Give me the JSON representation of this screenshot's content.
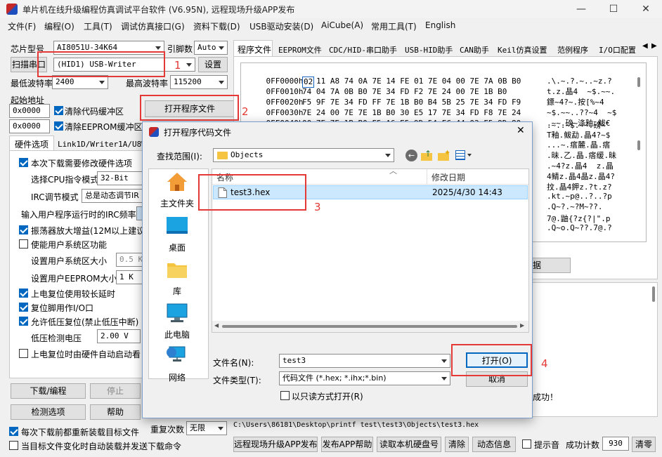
{
  "window": {
    "title": "单片机在线升级编程仿真调试平台软件 (V6.95N), 远程现场升级APP发布",
    "minimize": "—",
    "maximize": "☐",
    "close": "✕"
  },
  "menu": [
    "文件(F)",
    "编程(O)",
    "工具(T)",
    "调试仿真接口(G)",
    "资料下载(D)",
    "USB驱动安装(D)",
    "AiCube(A)",
    "常用工具(T)",
    "English"
  ],
  "left": {
    "chip_label": "芯片型号",
    "chip_value": "AI8051U-34K64",
    "pin_label": "引脚数",
    "pin_value": "Auto",
    "scan_label": "扫描串口",
    "port_value": "(HID1) USB-Writer",
    "settings_btn": "设置",
    "min_baud_label": "最低波特率",
    "min_baud": "2400",
    "max_baud_label": "最高波特率",
    "max_baud": "115200",
    "start_addr_label": "起始地址",
    "addr1": "0x0000",
    "clear_code": "清除代码缓冲区",
    "addr2": "0x0000",
    "clear_eeprom": "清除EEPROM缓冲区",
    "open_prog_btn": "打开程序文件",
    "tab1": "硬件选项",
    "tab2": "Link1D/Writer1A/U8W脱",
    "opt_changehw": "本次下载需要修改硬件选项",
    "cpu_label": "选择CPU指令模式",
    "cpu_value": "32-Bit",
    "irc_label": "IRC调节模式",
    "irc_value": "总是动态调节IR",
    "irc_freq_label": "输入用户程序运行时的IRC频率",
    "osc_gain": "振荡器放大增益(12M以上建议",
    "user_sys": "使能用户系统区功能",
    "user_sys_size_label": "设置用户系统区大小",
    "user_sys_size": "0.5 K",
    "user_eeprom_label": "设置用户EEPROM大小",
    "user_eeprom": "1  K",
    "long_delay": "上电复位使用较长延时",
    "reset_io": "复位脚用作I/O口",
    "lvr": "允许低压复位(禁止低压中断)",
    "lvd_label": "低压检测电压",
    "lvd_value": "2.00 V",
    "auto_start": "上电复位时由硬件自动启动看",
    "download_btn": "下载/编程",
    "stop_btn": "停止",
    "check_btn": "检测选项",
    "help_btn": "帮助",
    "reload_each": "每次下载前都重新装载目标文件",
    "repeat_label": "重复次数",
    "repeat_value": "无限",
    "auto_send": "当目标文件变化时自动装载并发送下载命令"
  },
  "right": {
    "tabs": [
      "程序文件",
      "EEPROM文件",
      "CDC/HID-串口助手",
      "USB-HID助手",
      "CAN助手",
      "Keil仿真设置",
      "范例程序",
      "I/O口配置"
    ],
    "hex_rows": [
      {
        "addr": "0FF0000h",
        "first": "02",
        "bytes": "11 A8 74 0A 7E 14 FE 01 7E 04 00 7E 7A 0B B0",
        "ascii": ".\\.~.?.~..~z.?"
      },
      {
        "addr": "0FF0010h",
        "bytes": "74 04 7A 0B B0 7E 34 FD F2 7E 24 00 7E 1B B0",
        "ascii": "t.z.晶4  ~$.~~."
      },
      {
        "addr": "0FF0020h",
        "bytes": "F5 9F 7E 34 FD FF 7E 1B B0 B4 5B 25 7E 34 FD F9",
        "ascii": "鏢~4?~.按[%~4"
      },
      {
        "addr": "0FF0030h",
        "bytes": "7E 24 00 7E 7E 1B B0 30 E5 17 7E 34 FD F8 7E 24",
        "ascii": "~$.~~..??~4  ~$"
      },
      {
        "addr": "0FF0040h",
        "bytes": "00 7E 7E 1B B0 F5 A6 E5 9D 54 FC 44 03 F5 9D 80",
        "ascii": ".~~.磅~涤釉.鲅€"
      }
    ],
    "ascii_extra": [
      ".~..~$.~~.磅~`",
      "T釉.鲅勐.晶4?~$",
      "...~.瘩麓.晶.瘩",
      ".昧.乙.晶.瘩缓.昧",
      ".~4?z.晶4  z.晶",
      "4鲭z.晶4晶z.晶4?",
      "抆.晶4鉀z.?t.z?",
      ".kt.~p@..?..?p",
      ".Q~?.~?M~??.",
      "7@.鼬{?z{?|\".p",
      ".Q~o.Q~??.7@.?"
    ],
    "data_btn_fragment": "据",
    "path": "C:\\Users\\86181\\Desktop\\printf test\\test3\\Objects\\test3.hex",
    "status_tail": "成功！"
  },
  "bottom": {
    "publish": "远程现场升级APP发布",
    "publish_help": "发布APP帮助",
    "read_id": "读取本机硬盘号",
    "clear": "清除",
    "anim": "动态信息",
    "beep": "提示音",
    "count_label": "成功计数",
    "count": "930",
    "clear_count": "清零"
  },
  "dialog": {
    "title": "打开程序代码文件",
    "lookin_label": "查找范围(I):",
    "lookin_value": "Objects",
    "nav": [
      "主文件夹",
      "桌面",
      "库",
      "此电脑",
      "网络"
    ],
    "col_name": "名称",
    "col_date": "修改日期",
    "file_name": "test3.hex",
    "file_date": "2025/4/30 14:43",
    "filename_label": "文件名(N):",
    "filename_value": "test3",
    "filetype_label": "文件类型(T):",
    "filetype_value": "代码文件 (*.hex;  *.ihx;*.bin)",
    "readonly": "以只读方式打开(R)",
    "open_btn": "打开(O)",
    "cancel_btn": "取消"
  },
  "annotations": [
    "1",
    "2",
    "3",
    "4"
  ]
}
